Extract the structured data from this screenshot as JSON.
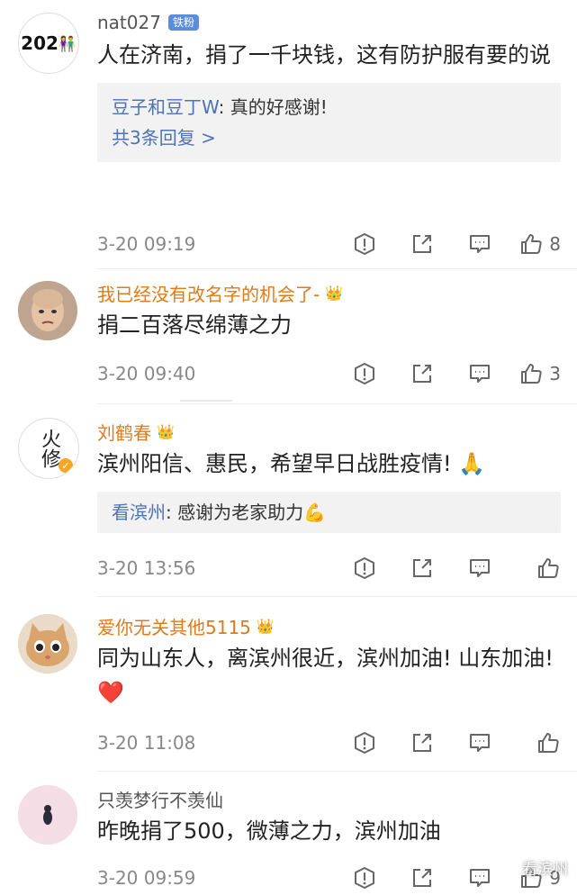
{
  "comments": [
    {
      "avatar_text": "202",
      "username": "nat027",
      "fan_badge": "铁粉",
      "text": "人在济南，捐了一千块钱，这有防护服有要的说",
      "reply": {
        "user": "豆子和豆丁W",
        "sep": ": ",
        "text": "真的好感谢!",
        "more": "共3条回复 >"
      },
      "time": "3-20 09:19",
      "likes": "8"
    },
    {
      "username": "我已经没有改名字的机会了-",
      "text": "捐二百落尽绵薄之力",
      "time": "3-20 09:40",
      "likes": "3"
    },
    {
      "avatar_text": "火修",
      "username": "刘鹤春",
      "text": "滨州阳信、惠民，希望早日战胜疫情! 🙏",
      "reply": {
        "user": "看滨州",
        "sep": ": ",
        "text": "感谢为老家助力💪"
      },
      "time": "3-20 13:56"
    },
    {
      "username": "爱你无关其他5115",
      "text": "同为山东人，离滨州很近，滨州加油! 山东加油! ❤️",
      "time": "3-20 11:08"
    },
    {
      "username": "只羡梦行不羡仙",
      "text": "昨晚捐了500，微薄之力，滨州加油",
      "time": "3-20 09:59",
      "likes": "9"
    }
  ],
  "watermark": "看滨州",
  "colors": {
    "orange_name": "#e07a17",
    "reply_link": "#4a73b8",
    "fan_badge": "#5b8ddb"
  }
}
